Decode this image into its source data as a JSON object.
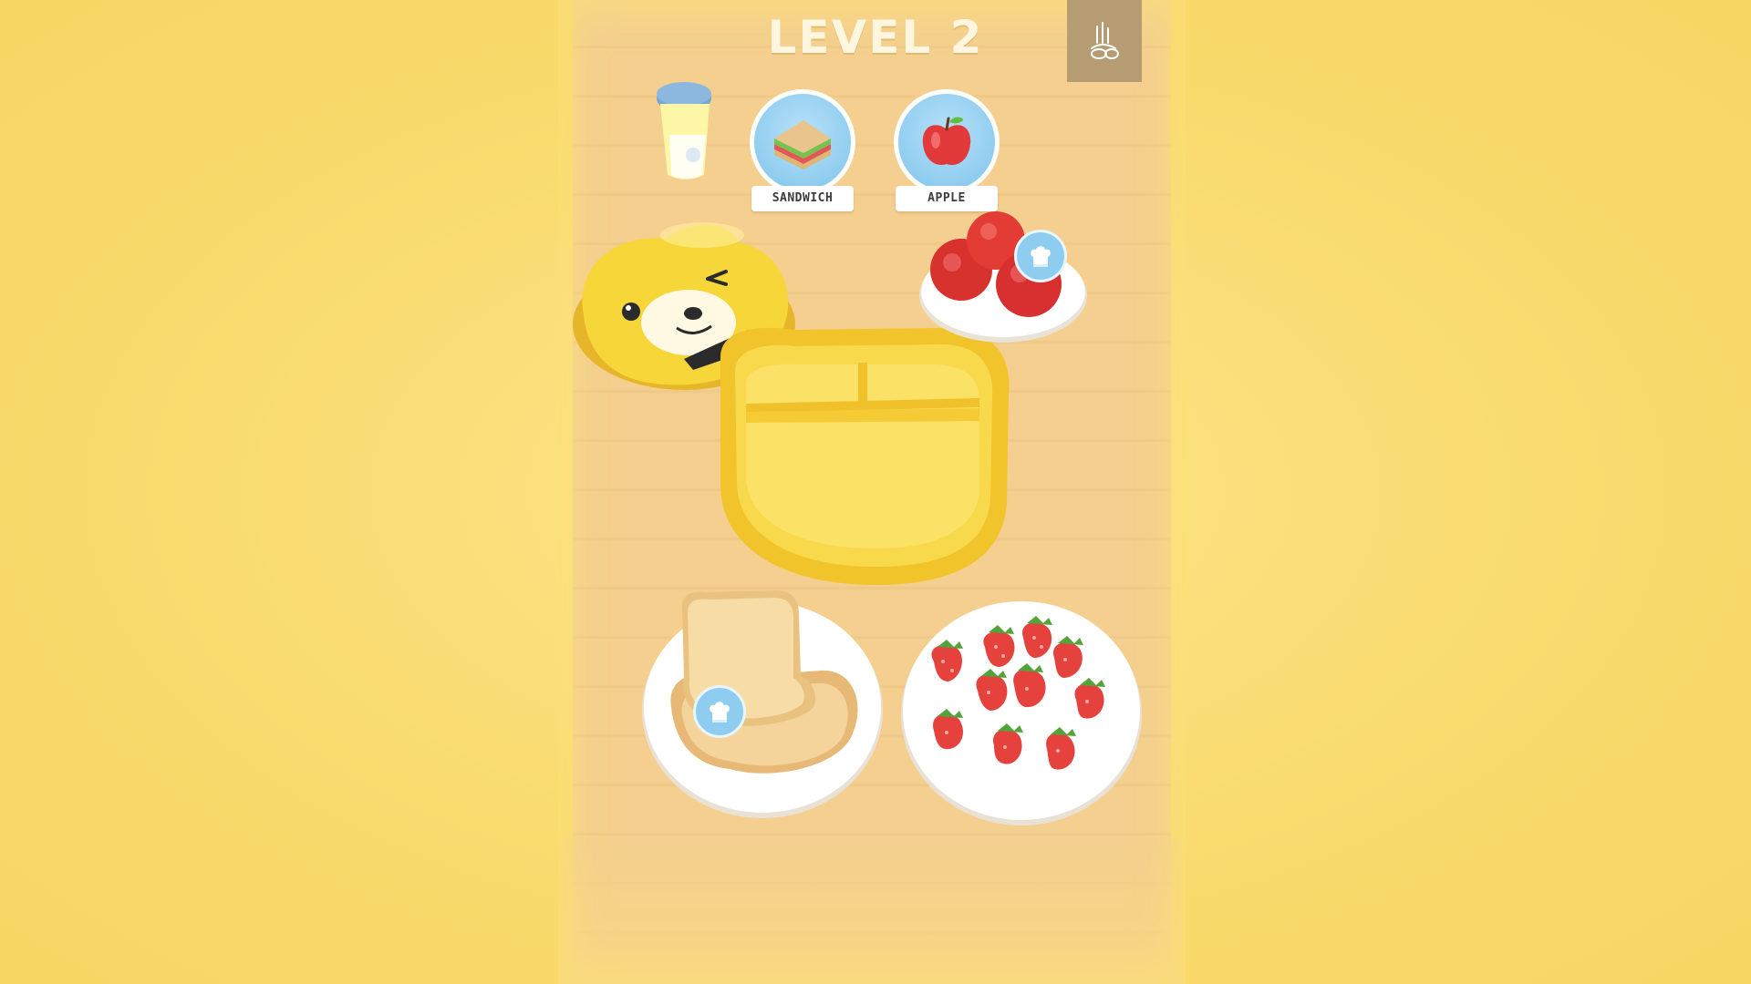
{
  "header": {
    "level_label": "LEVEL 2"
  },
  "settings": {
    "icon": "settings-icon"
  },
  "orders": [
    {
      "label": "SANDWICH",
      "icon": "sandwich-icon"
    },
    {
      "label": "APPLE",
      "icon": "apple-icon"
    }
  ],
  "scene": {
    "items": [
      "drink-cup",
      "bear-lunchbox-lid",
      "lunchbox-tray",
      "apple-plate",
      "bread-plate",
      "strawberry-plate"
    ]
  },
  "colors": {
    "background": "#fbe07a",
    "board": "#f4cf8f",
    "lunchbox": "#f7cd3a",
    "bubble": "#8fcdf0"
  }
}
